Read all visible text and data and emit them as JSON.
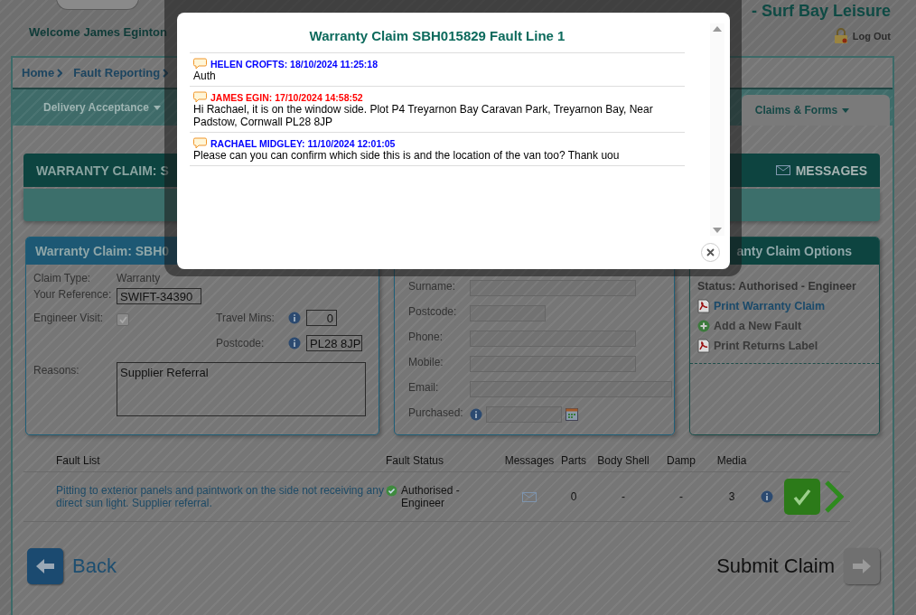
{
  "header": {
    "welcome": "Welcome James Eginton",
    "dealer": "- Surf Bay Leisure",
    "logout": "Log Out"
  },
  "breadcrumb": [
    "Home",
    "Fault Reporting"
  ],
  "nav": [
    {
      "label": "Delivery Acceptance",
      "selected": false
    },
    {
      "label": "Claims & Forms",
      "selected": true
    }
  ],
  "claim_bar": {
    "title": "WARRANTY CLAIM: S",
    "messages": "MESSAGES"
  },
  "claim_panel": {
    "title": "Warranty Claim: SBH0",
    "claim_type_label": "Claim Type:",
    "claim_type": "Warranty",
    "reference_label": "Your Reference:",
    "reference": "SWIFT-34390",
    "engineer_label": "Engineer Visit:",
    "engineer_visit": true,
    "travel_label": "Travel Mins:",
    "travel_mins": "0",
    "postcode_label": "Postcode:",
    "postcode": "PL28 8JP",
    "reasons_label": "Reasons:",
    "reasons": "Supplier Referral"
  },
  "customer_panel": {
    "fields": [
      {
        "label": "Surname:",
        "kind": "medium"
      },
      {
        "label": "Postcode:",
        "kind": "short"
      },
      {
        "label": "Phone:",
        "kind": "medium"
      },
      {
        "label": "Mobile:",
        "kind": "medium"
      },
      {
        "label": "Email:",
        "kind": "long"
      },
      {
        "label": "Purchased:",
        "kind": "date"
      }
    ]
  },
  "options_panel": {
    "title": "anty Claim Options",
    "status": "Status: Authorised - Engineer",
    "links": [
      {
        "label": "Print Warranty Claim",
        "kind": "pdf",
        "selected": true
      },
      {
        "label": "Add a New Fault",
        "kind": "add",
        "selected": false
      },
      {
        "label": "Print Returns Label",
        "kind": "pdf",
        "selected": false
      }
    ]
  },
  "fault_table": {
    "columns": [
      "Fault List",
      "Fault Status",
      "Messages",
      "Parts",
      "Body Shell",
      "Damp",
      "Media"
    ],
    "rows": [
      {
        "description": "Pitting to exterior panels and paintwork on the side not receiving any direct sun light. Supplier referral.",
        "status": "Authorised - Engineer",
        "parts": "0",
        "body_shell": "-",
        "damp": "-",
        "media": "3"
      }
    ]
  },
  "footer": {
    "back": "Back",
    "submit": "Submit Claim"
  },
  "modal": {
    "title": "Warranty Claim SBH015829 Fault Line 1",
    "messages": [
      {
        "author": "HELEN CROFTS: 18/10/2024 11:25:18",
        "color": "#0000ff",
        "text": "Auth"
      },
      {
        "author": "JAMES EGIN: 17/10/2024 14:58:52",
        "color": "#ff0000",
        "text": "Hi Rachael, it is on the window side. Plot P4 Treyarnon Bay Caravan Park, Treyarnon Bay, Near Padstow, Cornwall PL28 8JP"
      },
      {
        "author": "RACHAEL MIDGLEY: 11/10/2024 12:01:05",
        "color": "#0000ff",
        "text": "Please can you can confirm which side this is and the location of the van too? Thank uou"
      }
    ]
  }
}
